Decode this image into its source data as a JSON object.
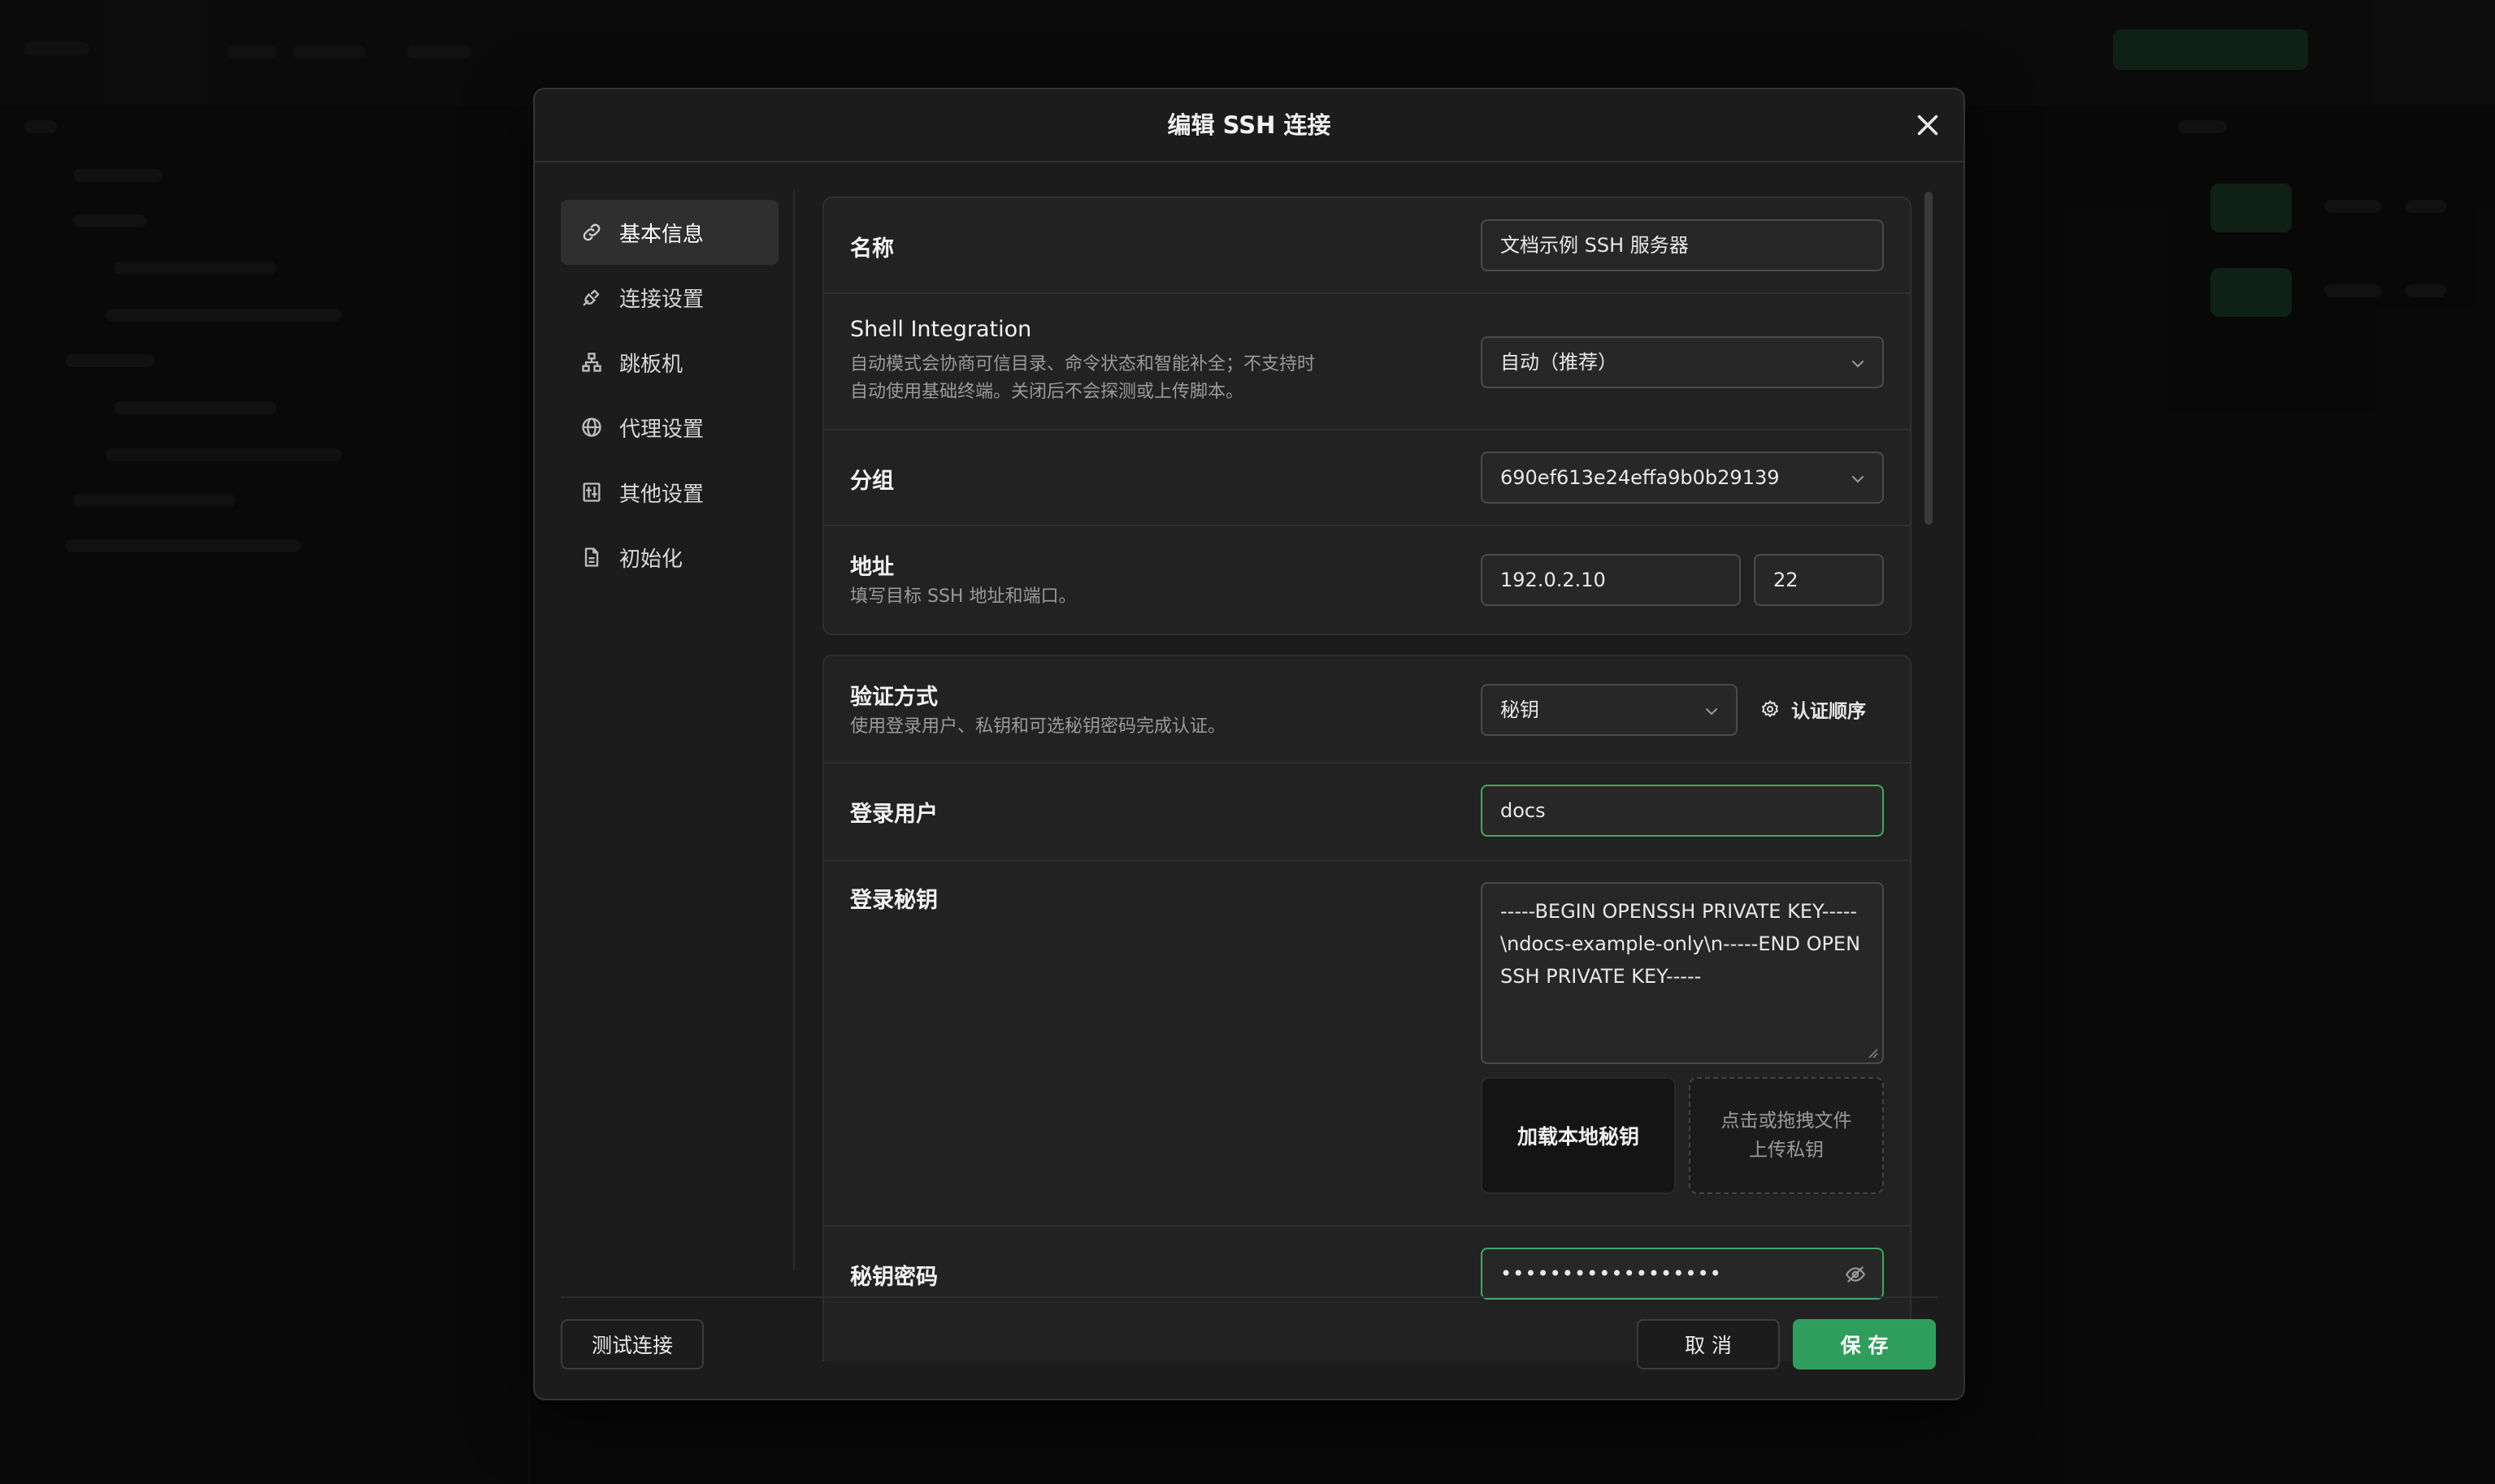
{
  "dialog": {
    "title": "编辑 SSH 连接"
  },
  "nav": {
    "items": [
      {
        "label": "基本信息",
        "icon": "link-icon",
        "active": true
      },
      {
        "label": "连接设置",
        "icon": "plug-icon",
        "active": false
      },
      {
        "label": "跳板机",
        "icon": "network-icon",
        "active": false
      },
      {
        "label": "代理设置",
        "icon": "globe-icon",
        "active": false
      },
      {
        "label": "其他设置",
        "icon": "settings-panel-icon",
        "active": false
      },
      {
        "label": "初始化",
        "icon": "document-icon",
        "active": false
      }
    ]
  },
  "basic": {
    "name_label": "名称",
    "name_value": "文档示例 SSH 服务器",
    "shell_label": "Shell Integration",
    "shell_desc_line1": "自动模式会协商可信目录、命令状态和智能补全；不支持时",
    "shell_desc_line2": "自动使用基础终端。关闭后不会探测或上传脚本。",
    "shell_value": "自动（推荐）",
    "group_label": "分组",
    "group_value": "690ef613e24effa9b0b29139",
    "address_label": "地址",
    "address_desc": "填写目标 SSH 地址和端口。",
    "host_value": "192.0.2.10",
    "port_value": "22"
  },
  "auth": {
    "method_label": "验证方式",
    "method_desc": "使用登录用户、私钥和可选秘钥密码完成认证。",
    "method_value": "秘钥",
    "order_label": "认证顺序",
    "user_label": "登录用户",
    "user_value": "docs",
    "key_label": "登录秘钥",
    "key_value": "-----BEGIN OPENSSH PRIVATE KEY-----\\ndocs-example-only\\n-----END OPENSSH PRIVATE KEY-----",
    "load_key_label": "加载本地秘钥",
    "upload_line1": "点击或拖拽文件",
    "upload_line2": "上传私钥",
    "passphrase_label": "秘钥密码",
    "passphrase_value": "••••••••••••••••••"
  },
  "footer": {
    "test_label": "测试连接",
    "cancel_label": "取 消",
    "save_label": "保 存"
  },
  "colors": {
    "accent": "#2f9e5c",
    "focus_border": "#3fa964"
  }
}
